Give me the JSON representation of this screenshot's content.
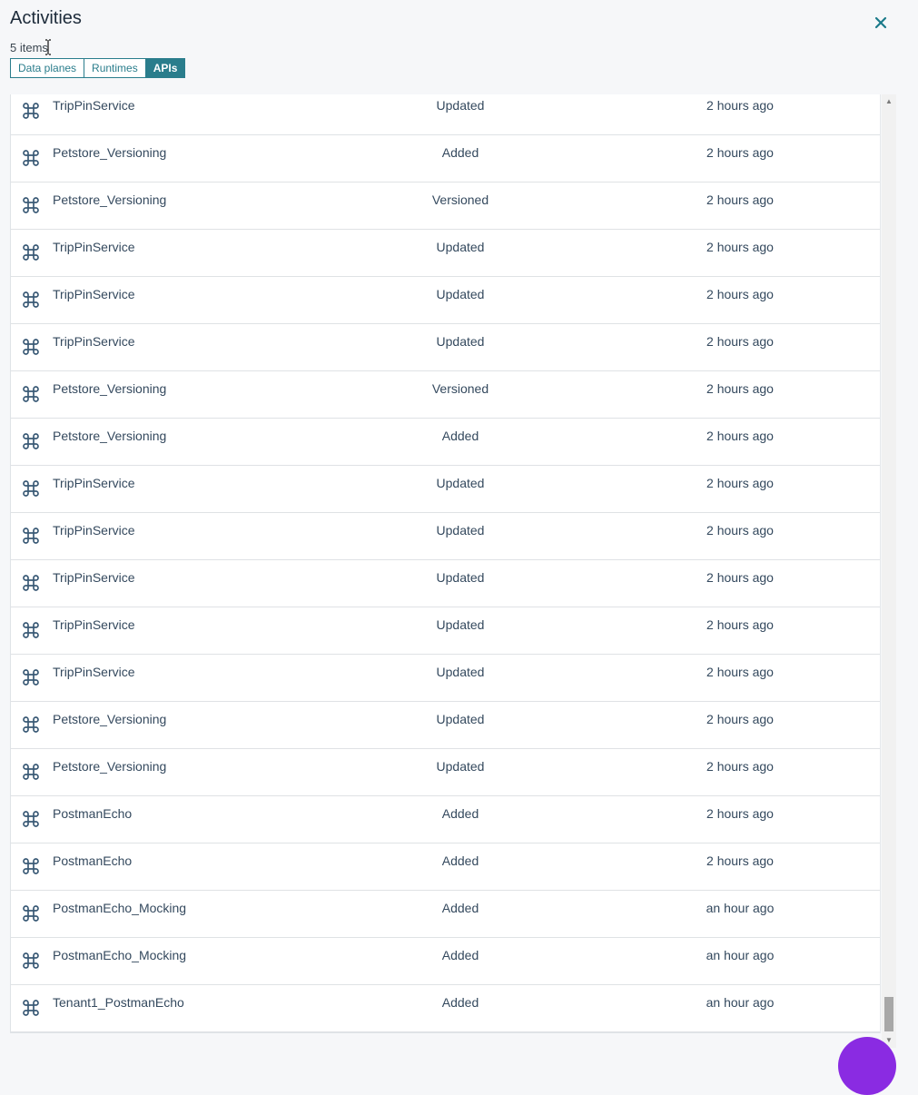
{
  "header": {
    "title": "Activities",
    "item_count": "5 items",
    "close_icon": "close-icon"
  },
  "tabs": [
    {
      "label": "Data planes",
      "active": false
    },
    {
      "label": "Runtimes",
      "active": false
    },
    {
      "label": "APIs",
      "active": true
    }
  ],
  "rows": [
    {
      "name": "TripPinService",
      "action": "Updated",
      "time": "2 hours ago",
      "icon": "api-command-icon"
    },
    {
      "name": "Petstore_Versioning",
      "action": "Added",
      "time": "2 hours ago",
      "icon": "api-command-icon"
    },
    {
      "name": "Petstore_Versioning",
      "action": "Versioned",
      "time": "2 hours ago",
      "icon": "api-command-icon"
    },
    {
      "name": "TripPinService",
      "action": "Updated",
      "time": "2 hours ago",
      "icon": "api-command-icon"
    },
    {
      "name": "TripPinService",
      "action": "Updated",
      "time": "2 hours ago",
      "icon": "api-command-icon"
    },
    {
      "name": "TripPinService",
      "action": "Updated",
      "time": "2 hours ago",
      "icon": "api-command-icon"
    },
    {
      "name": "Petstore_Versioning",
      "action": "Versioned",
      "time": "2 hours ago",
      "icon": "api-command-icon"
    },
    {
      "name": "Petstore_Versioning",
      "action": "Added",
      "time": "2 hours ago",
      "icon": "api-command-icon"
    },
    {
      "name": "TripPinService",
      "action": "Updated",
      "time": "2 hours ago",
      "icon": "api-command-icon"
    },
    {
      "name": "TripPinService",
      "action": "Updated",
      "time": "2 hours ago",
      "icon": "api-command-icon"
    },
    {
      "name": "TripPinService",
      "action": "Updated",
      "time": "2 hours ago",
      "icon": "api-command-icon"
    },
    {
      "name": "TripPinService",
      "action": "Updated",
      "time": "2 hours ago",
      "icon": "api-command-icon"
    },
    {
      "name": "TripPinService",
      "action": "Updated",
      "time": "2 hours ago",
      "icon": "api-command-icon"
    },
    {
      "name": "Petstore_Versioning",
      "action": "Updated",
      "time": "2 hours ago",
      "icon": "api-command-icon"
    },
    {
      "name": "Petstore_Versioning",
      "action": "Updated",
      "time": "2 hours ago",
      "icon": "api-command-icon"
    },
    {
      "name": "PostmanEcho",
      "action": "Added",
      "time": "2 hours ago",
      "icon": "api-command-icon"
    },
    {
      "name": "PostmanEcho",
      "action": "Added",
      "time": "2 hours ago",
      "icon": "api-command-icon"
    },
    {
      "name": "PostmanEcho_Mocking",
      "action": "Added",
      "time": "an hour ago",
      "icon": "api-command-icon"
    },
    {
      "name": "PostmanEcho_Mocking",
      "action": "Added",
      "time": "an hour ago",
      "icon": "api-command-icon"
    },
    {
      "name": "Tenant1_PostmanEcho",
      "action": "Added",
      "time": "an hour ago",
      "icon": "api-command-icon"
    }
  ],
  "colors": {
    "accent": "#2a7d8c",
    "fab": "#8a2be2"
  }
}
